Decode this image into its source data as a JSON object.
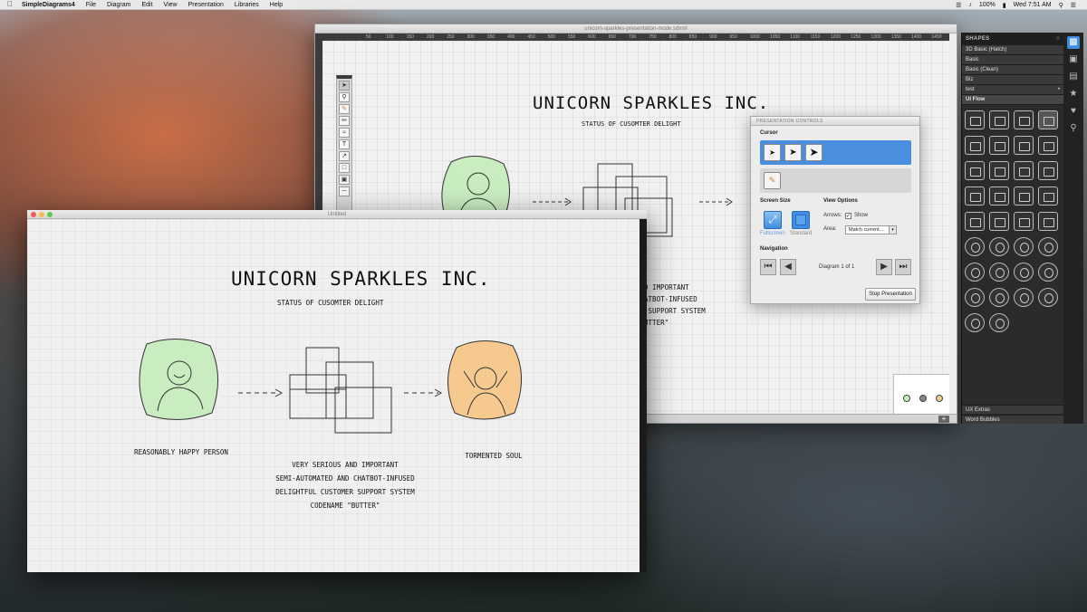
{
  "menubar": {
    "app": "SimpleDiagrams4",
    "items": [
      "File",
      "Diagram",
      "Edit",
      "View",
      "Presentation",
      "Libraries",
      "Help"
    ],
    "battery": "100%",
    "clock": "Wed 7:51 AM"
  },
  "back_window": {
    "title": "unicorn-sparkles-presentation-mode.sdxml",
    "ruler_ticks": [
      "50",
      "100",
      "150",
      "200",
      "250",
      "300",
      "350",
      "400",
      "450",
      "500",
      "550",
      "600",
      "650",
      "700",
      "750",
      "800",
      "850",
      "900",
      "950",
      "1000",
      "1050",
      "1100",
      "1150",
      "1200",
      "1250",
      "1300",
      "1350",
      "1400",
      "1450"
    ],
    "diagram": {
      "title": "Unicorn Sparkles Inc.",
      "subtitle": "Status of cusomter delight",
      "caption_lines": [
        "and important",
        "chatbot-infused",
        "er support system",
        "\"Butter\""
      ]
    }
  },
  "presentation_controls": {
    "header": "PRESENTATION CONTROLS",
    "cursor_label": "Cursor",
    "screen_size_label": "Screen Size",
    "fullscreen_label": "Fullscreen",
    "standard_label": "Standard",
    "view_options_label": "View Options",
    "arrows_label": "Arrows:",
    "show_label": "Show",
    "area_label": "Area:",
    "area_value": "Match current...",
    "navigation_label": "Navigation",
    "diagram_counter": "Diagram 1 of 1",
    "stop_button": "Stop Presentation"
  },
  "shapes_panel": {
    "header": "SHAPES",
    "libraries": [
      "3D Basic (Hatch)",
      "Basic",
      "Basic (Clean)",
      "Biz",
      "test",
      "UI Flow"
    ],
    "selected_library": "UI Flow",
    "bottom_libraries": [
      "UX Extras",
      "Word Bubbles"
    ]
  },
  "front_window": {
    "title": "Untitled",
    "diagram": {
      "title": "Unicorn Sparkles Inc.",
      "subtitle": "Status of cusomter delight",
      "left_caption": "Reasonably happy person",
      "middle_caption_lines": [
        "Very serious and important",
        "semi-automated and chatbot-infused",
        "delightful customer support system",
        "codename \"Butter\""
      ],
      "right_caption": "Tormented soul"
    }
  },
  "colors": {
    "happy_fill": "#c9ecc1",
    "tormented_fill": "#f6c98f",
    "accent_blue": "#4a8ee0"
  }
}
